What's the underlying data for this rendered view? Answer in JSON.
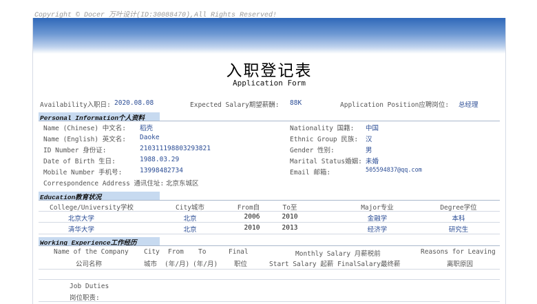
{
  "copyright": "Copyright © Docer 万叶设计(ID:30088470),All Rights Reserved!",
  "title": "入职登记表",
  "subtitle": "Application Form",
  "top_row": {
    "availability_label": "Availability入职日:",
    "availability_value": "2020.08.08",
    "salary_label": "Expected Salary期望薪酬:",
    "salary_value": "88K",
    "position_label": "Application Position应聘岗位:",
    "position_value": "总经理"
  },
  "personal": {
    "header": "Personal Information个人资料",
    "name_cn_label": "Name (Chinese) 中文名:",
    "name_cn": "稻壳",
    "name_en_label": "Name (English) 英文名:",
    "name_en": "Daoke",
    "id_label": "ID Number 身份证:",
    "id": "210311198803293821",
    "dob_label": "Date of Birth 生日:",
    "dob": "1988.03.29",
    "mobile_label": "Mobile Number 手机号:",
    "mobile": "13998482734",
    "address_label": "Correspondence Address 通讯住址:",
    "address": "北京东城区",
    "nationality_label": "Nationality 国籍:",
    "nationality": "中国",
    "ethnic_label": "Ethnic Group 民族:",
    "ethnic": "汉",
    "gender_label": "Gender 性别:",
    "gender": "男",
    "marital_label": "Marital Status婚姻:",
    "marital": "未婚",
    "email_label": "Email 邮箱:",
    "email": "505594837@qq.com"
  },
  "education": {
    "header": "Education教育状况",
    "columns": [
      "College/University学校",
      "City城市",
      "From自",
      "To至",
      "Major专业",
      "Degree学位"
    ],
    "rows": [
      {
        "school": "北京大学",
        "city": "北京",
        "from": "2006",
        "to": "2010",
        "major": "金融学",
        "degree": "本科"
      },
      {
        "school": "清华大学",
        "city": "北京",
        "from": "2010",
        "to": "2013",
        "major": "经济学",
        "degree": "研究生"
      }
    ]
  },
  "work": {
    "header": "Working Experience工作经历",
    "h1_company": "Name of the Company",
    "h2_company": "公司名称",
    "h1_city": "City",
    "h2_city": "城市",
    "h1_from": "From",
    "h2_from": "(年/月)",
    "h1_to": "To",
    "h2_to": "(年/月)",
    "h1_final": "Final",
    "h2_final": "职位",
    "h1_salary": "Monthly Salary 月薪税前",
    "h2_salary": "Start Salary 起薪  FinalSalary最终薪",
    "h1_reason": "Reasons for Leaving",
    "h2_reason": "离职原因",
    "duties_label": "Job Duties",
    "duties_label_cn": "岗位职责:"
  }
}
